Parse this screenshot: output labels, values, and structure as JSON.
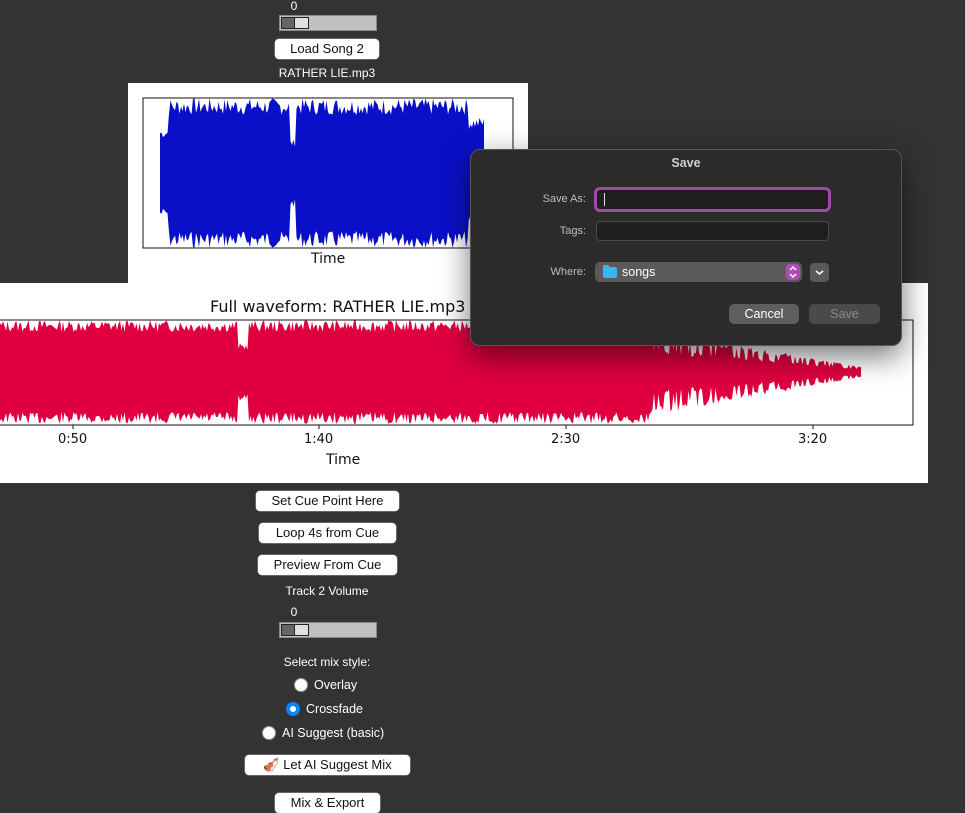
{
  "track1": {
    "volume_value": "0",
    "load_button": "Load Song 2",
    "song_name": "RATHER LIE.mp3",
    "mini_xlabel": "Time"
  },
  "full_waveform": {
    "title": "Full waveform: RATHER LIE.mp3",
    "ticks": [
      "0:50",
      "1:40",
      "2:30",
      "3:20"
    ],
    "xlabel": "Time"
  },
  "controls": {
    "set_cue": "Set Cue Point Here",
    "loop": "Loop 4s from Cue",
    "preview": "Preview From Cue",
    "track2_volume_label": "Track 2 Volume",
    "track2_volume_value": "0",
    "mix_style_label": "Select mix style:",
    "mix_options": [
      "Overlay",
      "Crossfade",
      "AI Suggest (basic)"
    ],
    "selected_mix": "Crossfade",
    "ai_button": "🎻 Let AI Suggest Mix",
    "mix_export": "Mix & Export"
  },
  "save_dialog": {
    "title": "Save",
    "save_as_label": "Save As:",
    "save_as_value": "",
    "tags_label": "Tags:",
    "tags_value": "",
    "where_label": "Where:",
    "where_value": "songs",
    "cancel": "Cancel",
    "save": "Save"
  },
  "colors": {
    "mini_wave": "#0a10c8",
    "full_wave": "#e0003f",
    "focus_ring": "#a04aa8",
    "radio_selected": "#0a84ff"
  }
}
